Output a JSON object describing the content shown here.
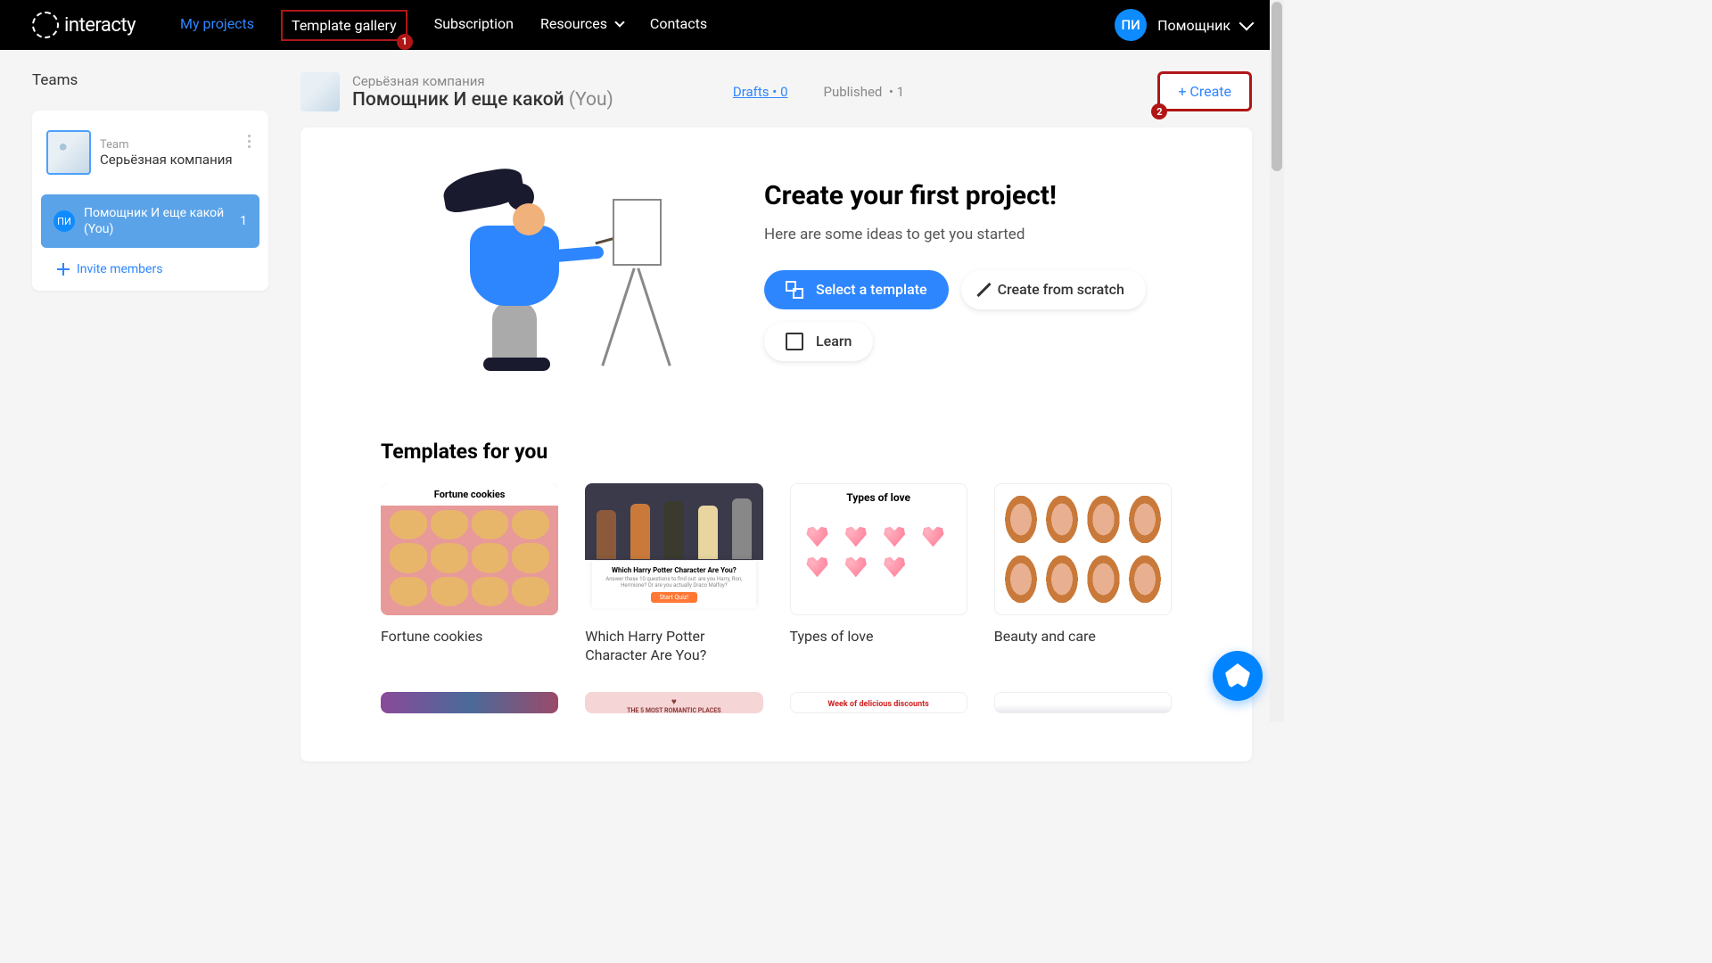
{
  "header": {
    "logo": "interacty",
    "nav": {
      "my_projects": "My projects",
      "template_gallery": "Template gallery",
      "subscription": "Subscription",
      "resources": "Resources",
      "contacts": "Contacts",
      "badge_1": "1"
    },
    "user": {
      "initials": "ПИ",
      "name": "Помощник"
    }
  },
  "sidebar": {
    "title": "Teams",
    "team": {
      "label": "Team",
      "name": "Серьёзная компания"
    },
    "member": {
      "initials": "ПИ",
      "name": "Помощник И еще какой (You)",
      "count": "1"
    },
    "invite": "Invite members"
  },
  "main_header": {
    "company": "Серьёзная компания",
    "user": "Помощник И еще какой",
    "you": "(You)",
    "drafts_label": "Drafts",
    "drafts_count": "0",
    "published_label": "Published",
    "published_count": "1",
    "create_btn": "+ Create",
    "create_badge": "2"
  },
  "hero": {
    "title": "Create your first project!",
    "subtitle": "Here are some ideas to get you started",
    "btn_template": "Select a template",
    "btn_scratch": "Create from scratch",
    "btn_learn": "Learn"
  },
  "templates": {
    "heading": "Templates for you",
    "items": [
      {
        "title": "Fortune cookies"
      },
      {
        "title": "Which Harry Potter Character Are You?"
      },
      {
        "title": "Types of love"
      },
      {
        "title": "Beauty and care"
      }
    ],
    "harry_thumb": {
      "question": "Which Harry Potter Character Are You?",
      "desc": "Answer these 10 questions to find out: are you Harry, Ron, Hermione? Or are you actually Draco Malfoy?",
      "btn": "Start Quiz!"
    },
    "romantic_thumb": "THE 5 MOST ROMANTIC PLACES",
    "discounts_thumb": "Week of delicious discounts"
  }
}
